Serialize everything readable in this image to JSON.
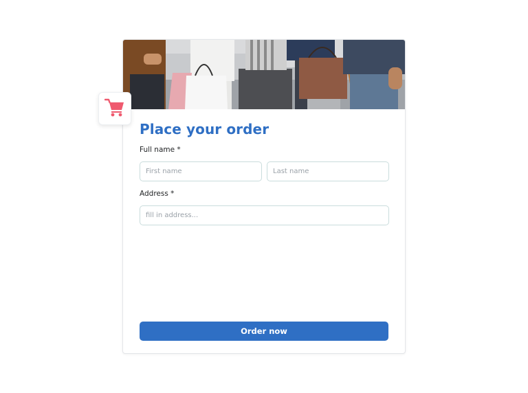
{
  "form": {
    "title": "Place your order",
    "full_name_label": "Full name *",
    "first_name_placeholder": "First name",
    "last_name_placeholder": "Last name",
    "address_label": "Address *",
    "address_placeholder": "fill in address...",
    "submit_label": "Order now"
  },
  "icons": {
    "cart": "shopping-cart-icon",
    "hero": "shoppers-with-bags-photo"
  },
  "colors": {
    "accent": "#2f6fc4",
    "cart_icon": "#ef5a6f",
    "input_border": "#c9dcdc"
  }
}
